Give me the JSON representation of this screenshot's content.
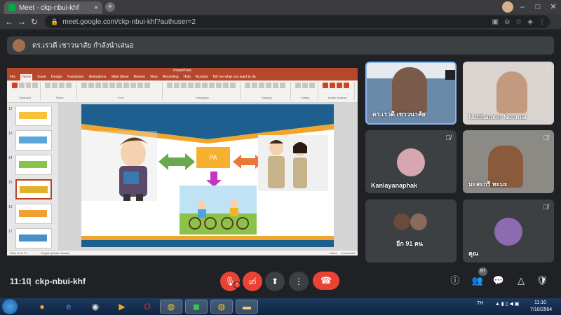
{
  "browser": {
    "tab_title": "Meet - ckp-nbui-khf",
    "tab_close": "×",
    "new_tab": "+",
    "url": "meet.google.com/ckp-nbui-khf?authuser=2",
    "win_min": "–",
    "win_max": "□",
    "win_close": "✕"
  },
  "presenter": {
    "text": "ดร.เรวดี เชาวนาสัย กำลังนำเสนอ"
  },
  "powerpoint": {
    "title": "PowerPoint",
    "tabs": [
      "File",
      "Home",
      "Insert",
      "Design",
      "Transitions",
      "Animations",
      "Slide Show",
      "Review",
      "View",
      "Recording",
      "Help",
      "Acrobat",
      "Tell me what you want to do"
    ],
    "ribbon_groups": [
      "Clipboard",
      "Slides",
      "Font",
      "Paragraph",
      "Drawing",
      "Editing",
      "Adobe Acrobat"
    ],
    "thumb_numbers": [
      "12",
      "13",
      "14",
      "15",
      "16",
      "17"
    ],
    "selected_thumb": 3,
    "slide_label": "PA",
    "status_left": "Slide 15 of 71",
    "status_lang": "English (United States)",
    "status_right": [
      "Notes",
      "Comments"
    ]
  },
  "tiles": [
    {
      "name": "ดร.เรวดี เชาวนาสัย",
      "active": true
    },
    {
      "name": "Nutthamon Noomai"
    },
    {
      "name": "Kanlayanaphak"
    },
    {
      "name": "มะสะกรี หะมะ"
    },
    {
      "name": "อีก 91 คน"
    },
    {
      "name": "คุณ"
    }
  ],
  "bottom": {
    "time": "11:10",
    "meeting_code": "ckp-nbui-khf",
    "participant_count": "97",
    "mic_alert": "!"
  },
  "taskbar": {
    "lang": "TH",
    "time": "11:10",
    "date": "7/10/2564"
  },
  "colors": {
    "accent_red": "#ea4335",
    "pp_brand": "#b7472a",
    "meet_bg": "#202124"
  }
}
